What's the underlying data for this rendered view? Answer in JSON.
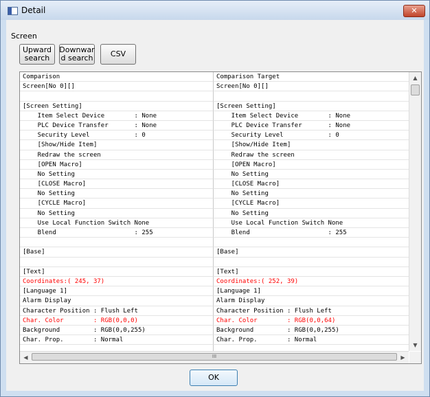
{
  "window": {
    "title": "Detail",
    "close_label": "✕"
  },
  "screen_label": "Screen",
  "toolbar": {
    "upward_search": "Upward search",
    "downward_search": "Downwar d search",
    "csv": "CSV"
  },
  "table": {
    "headers": [
      "Comparison",
      "Comparison Target"
    ],
    "rows": [
      [
        "Screen[No 0][]",
        "Screen[No 0][]",
        false
      ],
      [
        "",
        "",
        false
      ],
      [
        "[Screen Setting]",
        "[Screen Setting]",
        false
      ],
      [
        "    Item Select Device        : None",
        "    Item Select Device        : None",
        false
      ],
      [
        "    PLC Device Transfer       : None",
        "    PLC Device Transfer       : None",
        false
      ],
      [
        "    Security Level            : 0",
        "    Security Level            : 0",
        false
      ],
      [
        "    [Show/Hide Item]",
        "    [Show/Hide Item]",
        false
      ],
      [
        "    Redraw the screen",
        "    Redraw the screen",
        false
      ],
      [
        "    [OPEN Macro]",
        "    [OPEN Macro]",
        false
      ],
      [
        "    No Setting",
        "    No Setting",
        false
      ],
      [
        "    [CLOSE Macro]",
        "    [CLOSE Macro]",
        false
      ],
      [
        "    No Setting",
        "    No Setting",
        false
      ],
      [
        "    [CYCLE Macro]",
        "    [CYCLE Macro]",
        false
      ],
      [
        "    No Setting",
        "    No Setting",
        false
      ],
      [
        "    Use Local Function Switch None",
        "    Use Local Function Switch None",
        false
      ],
      [
        "    Blend                     : 255",
        "    Blend                     : 255",
        false
      ],
      [
        "",
        "",
        false
      ],
      [
        "[Base]",
        "[Base]",
        false
      ],
      [
        "",
        "",
        false
      ],
      [
        "[Text]",
        "[Text]",
        false
      ],
      [
        "Coordinates:( 245, 37)",
        "Coordinates:( 252, 39)",
        true
      ],
      [
        "[Language 1]",
        "[Language 1]",
        false
      ],
      [
        "Alarm Display",
        "Alarm Display",
        false
      ],
      [
        "Character Position : Flush Left",
        "Character Position : Flush Left",
        false
      ],
      [
        "Char. Color        : RGB(0,0,0)",
        "Char. Color        : RGB(0,0,64)",
        true
      ],
      [
        "Background         : RGB(0,0,255)",
        "Background         : RGB(0,0,255)",
        false
      ],
      [
        "Char. Prop.        : Normal",
        "Char. Prop.        : Normal",
        false
      ],
      [
        "",
        "",
        false
      ]
    ]
  },
  "scrollbar": {
    "up": "▲",
    "down": "▼",
    "left": "◀",
    "right": "▶",
    "grip": "III"
  },
  "ok_label": "OK",
  "colors": {
    "diff": "#ff0000",
    "window_frame": "#cfdff0",
    "close": "#c0442a"
  },
  "icons": [
    "window-icon",
    "close-icon"
  ]
}
